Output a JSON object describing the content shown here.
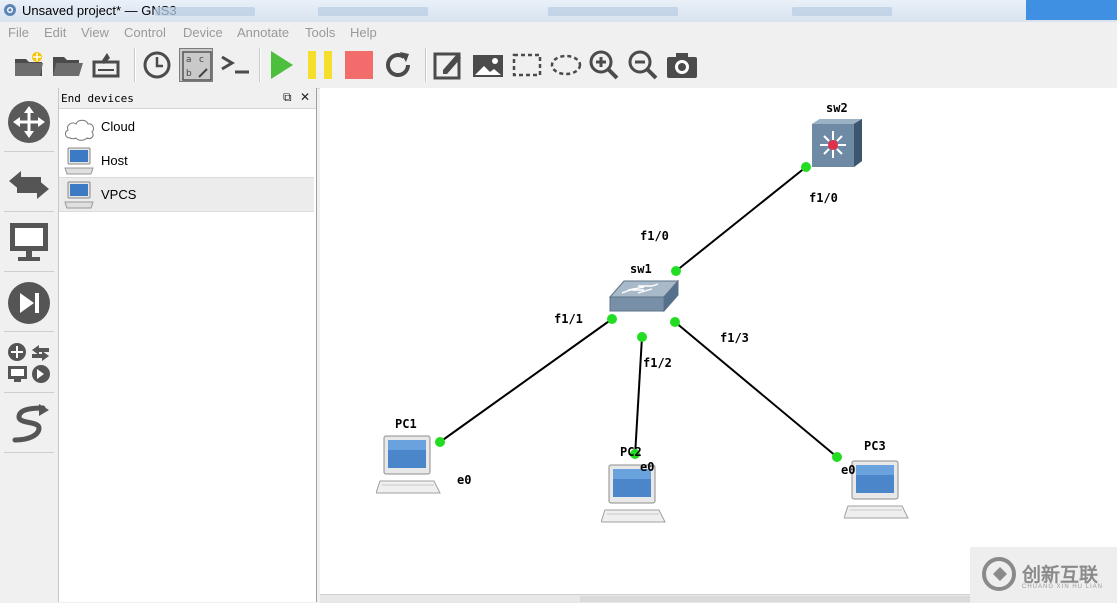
{
  "window": {
    "title": "Unsaved project* — GNS3"
  },
  "menu": [
    "File",
    "Edit",
    "View",
    "Control",
    "Device",
    "Annotate",
    "Tools",
    "Help"
  ],
  "toolbar": [
    {
      "name": "new-project-icon"
    },
    {
      "name": "open-project-icon"
    },
    {
      "name": "save-project-icon"
    },
    {
      "name": "clock-icon"
    },
    {
      "name": "show-interface-labels-icon"
    },
    {
      "name": "console-icon"
    },
    {
      "name": "start-icon"
    },
    {
      "name": "pause-icon"
    },
    {
      "name": "stop-icon"
    },
    {
      "name": "reload-icon"
    },
    {
      "name": "add-note-icon"
    },
    {
      "name": "insert-picture-icon"
    },
    {
      "name": "draw-rectangle-icon"
    },
    {
      "name": "draw-ellipse-icon"
    },
    {
      "name": "zoom-in-icon"
    },
    {
      "name": "zoom-out-icon"
    },
    {
      "name": "screenshot-icon"
    }
  ],
  "left_panel": [
    "browse-routers-icon",
    "browse-switches-icon",
    "browse-end-devices-icon",
    "browse-security-devices-icon",
    "browse-all-devices-icon",
    "add-link-icon"
  ],
  "dock": {
    "title": "End devices",
    "devices": [
      {
        "label": "Cloud",
        "icon": "cloud-icon"
      },
      {
        "label": "Host",
        "icon": "host-icon"
      },
      {
        "label": "VPCS",
        "icon": "vpcs-icon",
        "selected": true
      }
    ]
  },
  "topology": {
    "nodes": [
      {
        "id": "sw2",
        "label": "sw2",
        "type": "multilayer-switch"
      },
      {
        "id": "sw1",
        "label": "sw1",
        "type": "ethernet-switch"
      },
      {
        "id": "PC1",
        "label": "PC1",
        "type": "vpcs"
      },
      {
        "id": "PC2",
        "label": "PC2",
        "type": "vpcs"
      },
      {
        "id": "PC3",
        "label": "PC3",
        "type": "vpcs"
      }
    ],
    "links": [
      {
        "from": "sw1",
        "to": "sw2",
        "from_port": "f1/0",
        "to_port": "f1/0"
      },
      {
        "from": "sw1",
        "to": "PC1",
        "from_port": "f1/1",
        "to_port": "e0"
      },
      {
        "from": "sw1",
        "to": "PC2",
        "from_port": "f1/2",
        "to_port": "e0"
      },
      {
        "from": "sw1",
        "to": "PC3",
        "from_port": "f1/3",
        "to_port": "e0"
      }
    ],
    "port_labels": [
      "f1/0",
      "f1/0",
      "f1/1",
      "f1/2",
      "f1/3",
      "e0",
      "e0",
      "e0"
    ],
    "link_status_color": "#22dd22"
  },
  "watermark": {
    "text": "创新互联",
    "sub": "CHUANG XIN HU LIAN"
  }
}
